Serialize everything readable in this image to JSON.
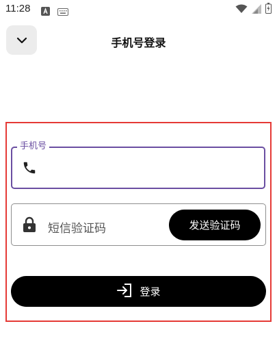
{
  "status_bar": {
    "time": "11:28",
    "icons": [
      "app-notification-icon",
      "keyboard-icon",
      "wifi-icon",
      "signal-icon",
      "battery-icon"
    ]
  },
  "header": {
    "title": "手机号登录",
    "back_icon": "chevron-down-icon"
  },
  "form": {
    "phone": {
      "label": "手机号",
      "value": "",
      "icon": "phone-icon"
    },
    "sms_code": {
      "placeholder": "短信验证码",
      "icon": "lock-icon",
      "send_button_label": "发送验证码"
    },
    "login_button": {
      "label": "登录",
      "icon": "login-icon"
    }
  },
  "colors": {
    "accent": "#6a4ea1",
    "highlight_border": "#e53935",
    "button_bg": "#000000",
    "back_button_bg": "#ececec"
  }
}
